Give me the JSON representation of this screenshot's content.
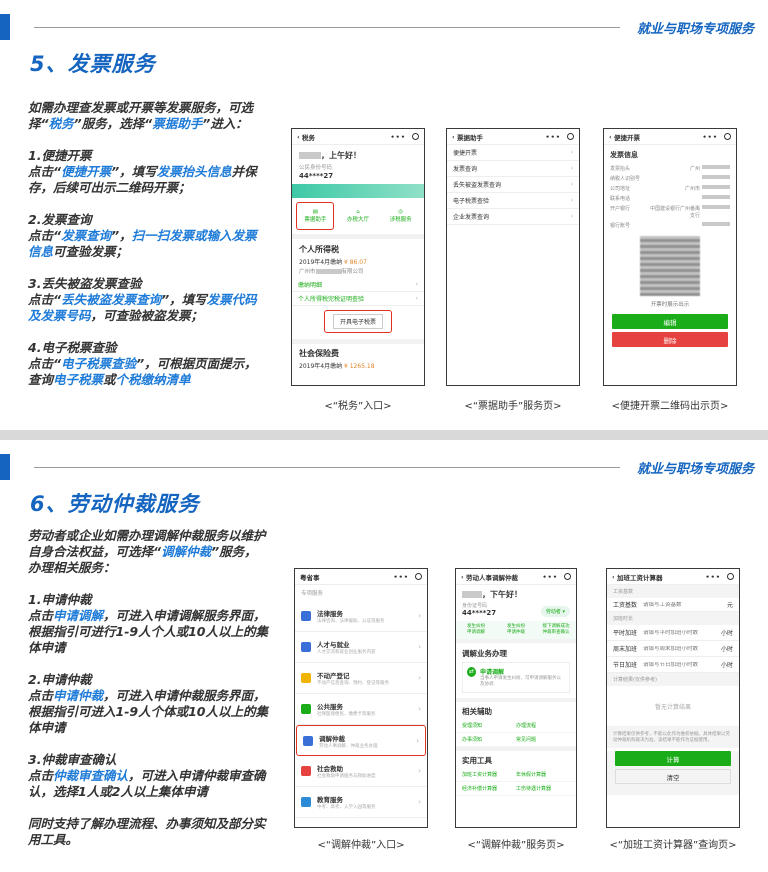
{
  "header_tag": "就业与职场专项服务",
  "section1": {
    "title": "5、发票服务",
    "intro": [
      {
        "t": "如需办理查发票或开票等发票服务，可选择“"
      },
      {
        "t": "税务",
        "hl": true
      },
      {
        "t": "”服务，选择“"
      },
      {
        "t": "票据助手",
        "hl": true
      },
      {
        "t": "”进入："
      }
    ],
    "items": [
      {
        "head": "1.便捷开票",
        "parts": [
          {
            "t": "点击“"
          },
          {
            "t": "便捷开票",
            "hl": true
          },
          {
            "t": "”，填写"
          },
          {
            "t": "发票抬头信息",
            "hl": true
          },
          {
            "t": "并保存，后续可出示二维码开票；"
          }
        ]
      },
      {
        "head": "2.发票查询",
        "parts": [
          {
            "t": "点击“"
          },
          {
            "t": "发票查询",
            "hl": true
          },
          {
            "t": "”，"
          },
          {
            "t": "扫一扫发票或输入发票信息",
            "hl": true
          },
          {
            "t": "可查验发票；"
          }
        ]
      },
      {
        "head": "3.丢失被盗发票查验",
        "parts": [
          {
            "t": "点击“"
          },
          {
            "t": "丢失被盗发票查询",
            "hl": true
          },
          {
            "t": "”，填写"
          },
          {
            "t": "发票代码及发票号码",
            "hl": true
          },
          {
            "t": "，可查验被盗发票；"
          }
        ]
      },
      {
        "head": "4.电子税票查验",
        "parts": [
          {
            "t": "点击“"
          },
          {
            "t": "电子税票查验",
            "hl": true
          },
          {
            "t": "”，可根据页面提示，查询"
          },
          {
            "t": "电子税票",
            "hl": true
          },
          {
            "t": "或"
          },
          {
            "t": "个税缴纳清单",
            "hl": true
          }
        ]
      }
    ],
    "captions": [
      "<“税务”入口>",
      "<“票据助手”服务页>",
      "<便捷开票二维码出示页>"
    ],
    "phone1": {
      "title": "税务",
      "greeting": "，上午好！",
      "id_label": "公民身份号码",
      "id_value": "44****27",
      "tabs": [
        "票据助手",
        "办税大厅",
        "涉税服务"
      ],
      "section": "个人所得税",
      "pay_line": "2019年4月缴纳",
      "pay_amount": "¥ 86.07",
      "company": "广州市",
      "company_suffix": "有限公司",
      "links": [
        "缴纳明细",
        "个人所得税完税证明查验"
      ],
      "button": "开具电子税票",
      "section2": "社会保险费",
      "pay_line2": "2019年4月缴纳",
      "pay_amount2": "¥ 1265.18"
    },
    "phone2": {
      "title": "票据助手",
      "items": [
        "便捷开票",
        "发票查询",
        "丢失被盗发票查询",
        "电子税票查验",
        "企业发票查询"
      ]
    },
    "phone3": {
      "title": "便捷开票",
      "heading": "发票信息",
      "fields": [
        "发票抬头",
        "纳税人识别号",
        "公司地址",
        "联系电话",
        "开户银行",
        "银行账号"
      ],
      "values": [
        "广州",
        "",
        "广州市",
        "",
        "中国建设银行广州番禺支行",
        ""
      ],
      "note": "开票时展示出示",
      "btn_edit": "编辑",
      "btn_delete": "删除"
    }
  },
  "section2": {
    "title": "6、劳动仲裁服务",
    "intro": [
      {
        "t": "劳动者或企业如需办理调解仲裁服务以维护自身合法权益，可选择“"
      },
      {
        "t": "调解仲裁",
        "hl": true
      },
      {
        "t": "”服务，办理相关服务："
      }
    ],
    "items": [
      {
        "head": "1.申请仲裁",
        "parts": [
          {
            "t": "点击"
          },
          {
            "t": "申请调解",
            "hl": true
          },
          {
            "t": "，可进入申请调解服务界面，根据指引可进行1-9人个人或10人以上的集体申请"
          }
        ]
      },
      {
        "head": "2.申请仲裁",
        "parts": [
          {
            "t": "点击"
          },
          {
            "t": "申请仲裁",
            "hl": true
          },
          {
            "t": "，可进入申请仲裁服务界面，根据指引可进入1-9人个体或10人以上的集体申请"
          }
        ]
      },
      {
        "head": "3.仲裁审查确认",
        "parts": [
          {
            "t": "点击"
          },
          {
            "t": "仲裁审查确认",
            "hl": true
          },
          {
            "t": "，可进入申请仲裁审查确认，选择1人或2人以上集体申请"
          }
        ]
      },
      {
        "head": "",
        "parts": [
          {
            "t": "同时支持了解办理流程、办事须知及部分实用工具。"
          }
        ]
      }
    ],
    "captions": [
      "<“调解仲裁”入口>",
      "<“调解仲裁”服务页>",
      "<“加班工资计算器”查询页>"
    ],
    "phone1": {
      "title": "粤省事",
      "sub": "专项服务",
      "items": [
        {
          "name": "法律服务",
          "desc": "法律咨询、法律援助、公证等服务",
          "color": "#3a6fd8"
        },
        {
          "name": "人才与就业",
          "desc": "人才交流和就业创业服务内容",
          "color": "#3a6fd8"
        },
        {
          "name": "不动产登记",
          "desc": "不动产信息查询、预约、登记等服务",
          "color": "#f0b400"
        },
        {
          "name": "公共服务",
          "desc": "社保医保便民、缴费卡等服务",
          "color": "#1aad19"
        },
        {
          "name": "调解仲裁",
          "desc": "劳动人事调解、仲裁业务办理",
          "color": "#3a6fd8"
        },
        {
          "name": "社会救助",
          "desc": "社会救助申请服务与救助进度",
          "color": "#e64340"
        },
        {
          "name": "教育服务",
          "desc": "中考、高考、入学入园等服务",
          "color": "#2a8bd8"
        }
      ]
    },
    "phone2": {
      "title": "劳动人事调解仲裁",
      "greeting": "，下午好！",
      "id_label": "身份证号码",
      "id_value": "44****27",
      "tag": "劳动者",
      "tabs": [
        "发生纠纷\n申请调解",
        "发生纠纷\n申请仲裁",
        "接下调解成功\n仲裁审查确认"
      ],
      "section": "调解业务办理",
      "apply_title": "申请调解",
      "apply_desc": "当事人申请发生纠纷，可申请调解服务以及协调",
      "section2": "相关辅助",
      "links2": [
        "受理须知",
        "办理流程",
        "办事须知",
        "常见问题"
      ],
      "section3": "实用工具",
      "links3": [
        "加班工资计算器",
        "年休假计算器",
        "经济补偿计算器",
        "工伤待遇计算器"
      ]
    },
    "phone3": {
      "title": "加班工资计算器",
      "group1": "工资基数",
      "base_label": "工资基数",
      "base_ph": "请填写工资基数",
      "base_unit": "元",
      "group2": "加班时长",
      "rows": [
        {
          "label": "平时加班",
          "ph": "请填写平时加班小时数",
          "unit": "小时"
        },
        {
          "label": "周末加班",
          "ph": "请填写周末加班小时数",
          "unit": "小时"
        },
        {
          "label": "节日加班",
          "ph": "请填写节日加班小时数",
          "unit": "小时"
        }
      ],
      "group3": "计算结果(仅供参考)",
      "result": "暂无计算结果",
      "note": "计算结果仅供参考，不能以此作为维权依据。具体结果以劳动仲裁机构裁决为准，该结果不能作为证据使用。",
      "btn_calc": "计算",
      "btn_clear": "清空"
    }
  }
}
